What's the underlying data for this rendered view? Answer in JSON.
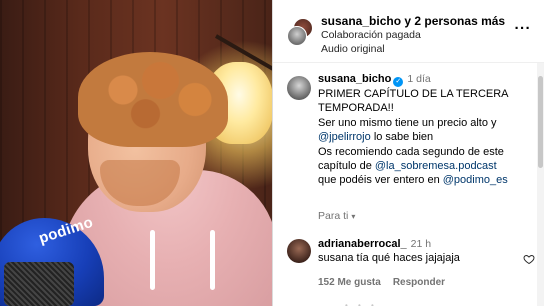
{
  "header": {
    "title_user": "susana_bicho",
    "title_rest": " y 2 personas más",
    "subtitle1": "Colaboración pagada",
    "subtitle2": "Audio original",
    "more_glyph": "···"
  },
  "video": {
    "mic_brand": "podimo"
  },
  "caption": {
    "username": "susana_bicho",
    "verified_glyph": "✓",
    "time": "1 día",
    "lines": [
      "PRIMER CAPÍTULO DE LA TERCERA",
      "TEMPORADA!!",
      "Ser uno mismo tiene un precio alto y",
      "lo sabe bien",
      "Os recomiendo cada segundo de este",
      "capítulo de",
      "que podéis ver entero en"
    ],
    "mentions": [
      "@jpelirrojo",
      "@la_sobremesa.podcast",
      "@podimo_es"
    ]
  },
  "translate": {
    "label": "Para ti",
    "chevron": "▾"
  },
  "comment": {
    "username": "adrianaberrocal_",
    "time": "21 h",
    "text": "susana tía qué haces jajajaja",
    "likes": "152 Me gusta",
    "reply": "Responder"
  },
  "icons": {
    "heart": "heart-outline-icon",
    "verified": "verified-badge-icon",
    "more": "more-horizontal-icon"
  },
  "colors": {
    "mention": "#00376b",
    "verified": "#0095f6",
    "muted": "#737373",
    "mic": "#173fb8"
  }
}
